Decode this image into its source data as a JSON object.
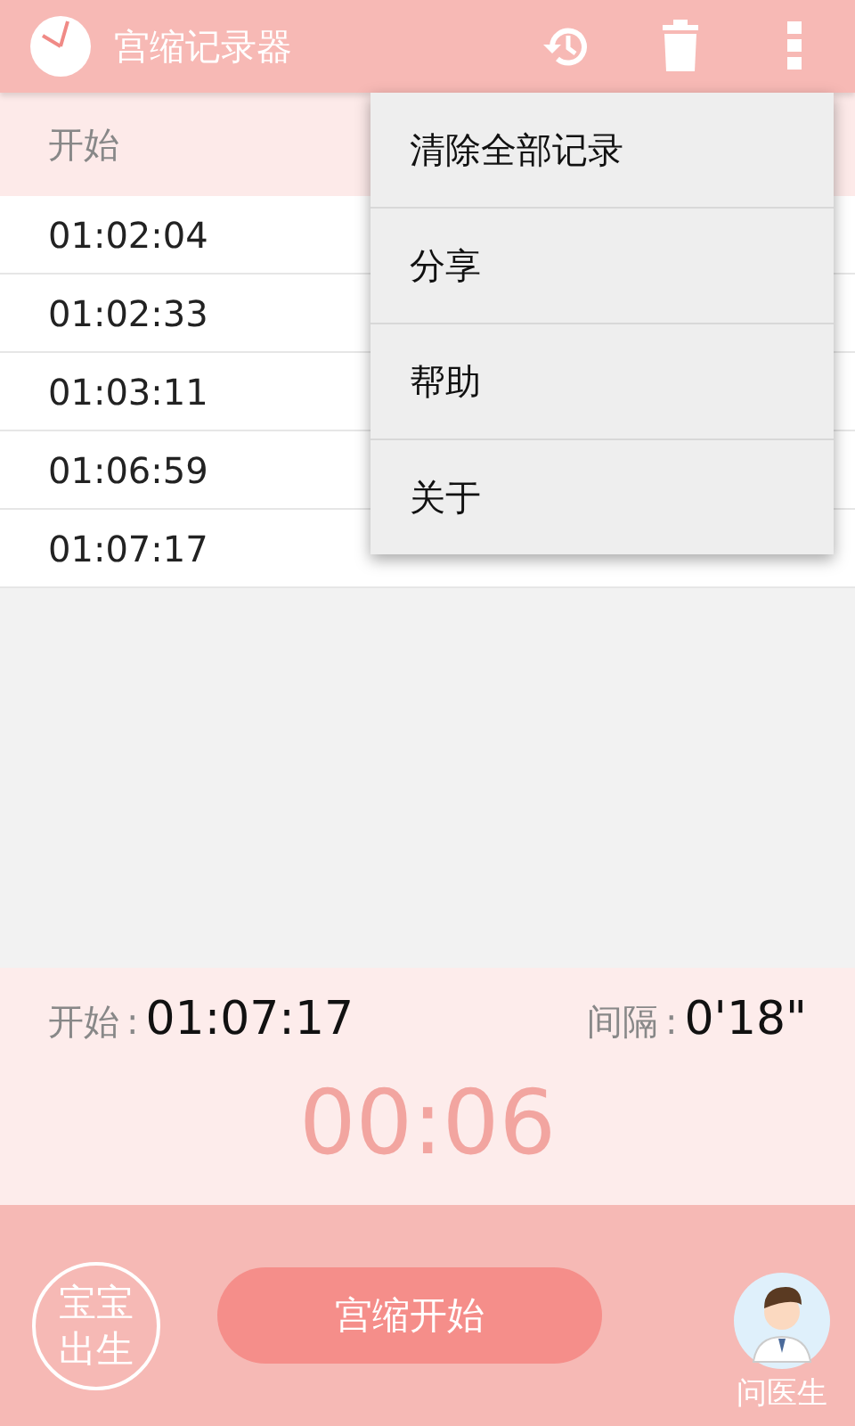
{
  "app_bar": {
    "title": "宫缩记录器"
  },
  "table": {
    "columns": [
      "开始"
    ],
    "rows": [
      [
        "01:02:04"
      ],
      [
        "01:02:33"
      ],
      [
        "01:03:11"
      ],
      [
        "01:06:59"
      ],
      [
        "01:07:17"
      ]
    ]
  },
  "menu": {
    "items": [
      "清除全部记录",
      "分享",
      "帮助",
      "关于"
    ]
  },
  "summary": {
    "start_label": "开始",
    "start_value": "01:07:17",
    "interval_label": "间隔",
    "interval_value": "0'18\"",
    "sep": ":",
    "timer": "00:06"
  },
  "bottom": {
    "birth_button": "宝宝出生",
    "start_button": "宫缩开始",
    "doctor_label": "问医生"
  }
}
